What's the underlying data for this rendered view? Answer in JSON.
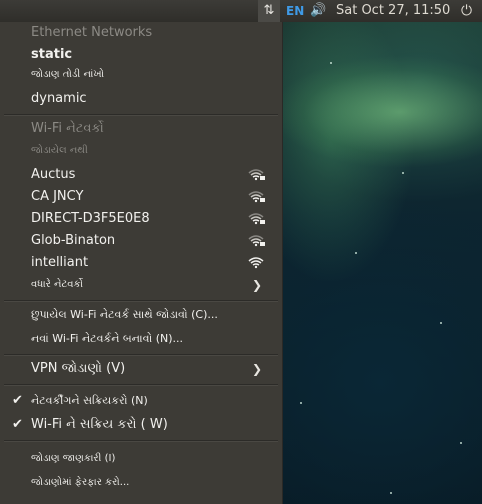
{
  "panel": {
    "network_icon": "⇅",
    "keyboard": "EN",
    "volume_icon": "🔊",
    "clock": "Sat Oct 27, 11:50",
    "power_icon": "⏻"
  },
  "menu": {
    "ethernet_header": "Ethernet Networks",
    "static": "static",
    "disconnect": "જોડાણ તોડી નાંખો",
    "dynamic": "dynamic",
    "wifi_header": "Wi-Fi નેટવર્કો",
    "not_connected": "જોડાયેલ નથી",
    "networks": [
      {
        "name": "Auctus",
        "signal": "wifi-locked-icon"
      },
      {
        "name": "CA JNCY",
        "signal": "wifi-locked-icon"
      },
      {
        "name": "DIRECT-D3F5E0E8",
        "signal": "wifi-locked-icon"
      },
      {
        "name": "Glob-Binaton",
        "signal": "wifi-locked-icon"
      },
      {
        "name": "intelliant",
        "signal": "wifi-full-icon"
      }
    ],
    "more_networks": "વધારે નેટવર્કો",
    "connect_hidden": "છુપાયેલ Wi-Fi નેટવર્ક સાથે જોડાવો (C)...",
    "create_new": "નવાં Wi-Fi નેટવર્કને બનાવો (N)...",
    "vpn": "VPN જોડાણો (V)",
    "enable_networking": "નેટવર્કીંગને સક્રિયકરો (N)",
    "enable_wifi": "Wi-Fi ને સક્રિય કરો ( W)",
    "connection_info": "જોડાણ જાણકારી (I)",
    "edit_connections": "જોડાણોમાં ફેરફાર કરો..."
  }
}
